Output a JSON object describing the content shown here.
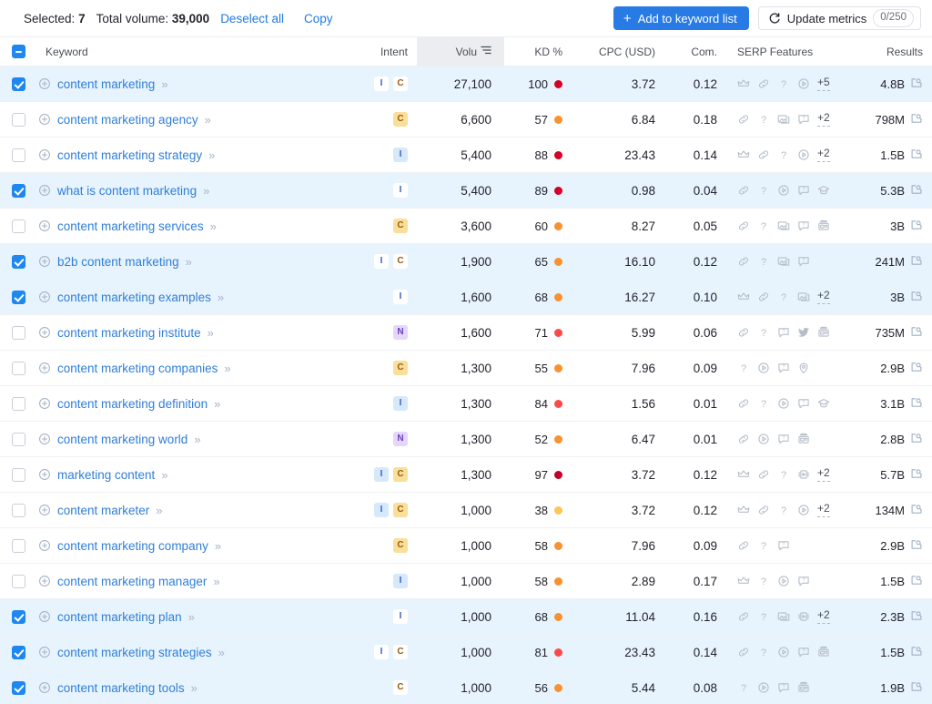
{
  "toolbar": {
    "selected_label": "Selected:",
    "selected_count": "7",
    "volume_label": "Total volume:",
    "volume_value": "39,000",
    "deselect_all": "Deselect all",
    "copy": "Copy",
    "add_to_list": "Add to keyword list",
    "update_metrics": "Update metrics",
    "update_quota": "0/250",
    "accent": "#287be5"
  },
  "table": {
    "columns": {
      "keyword": "Keyword",
      "intent": "Intent",
      "volume": "Volu",
      "kd": "KD %",
      "cpc": "CPC (USD)",
      "com": "Com.",
      "serp": "SERP Features",
      "results": "Results"
    },
    "sorted_column": "volume",
    "header_checkbox_state": "indeterminate",
    "rows": [
      {
        "selected": true,
        "keyword": "content marketing",
        "intents": [
          "I",
          "C"
        ],
        "volume": "27,100",
        "kd": "100",
        "kd_color": "#d40026",
        "cpc": "3.72",
        "com": "0.12",
        "serp": [
          "crown",
          "link",
          "question",
          "video"
        ],
        "serp_more": "+5",
        "results": "4.8B"
      },
      {
        "selected": false,
        "keyword": "content marketing agency",
        "intents": [
          "C"
        ],
        "volume": "6,600",
        "kd": "57",
        "kd_color": "#f8912f",
        "cpc": "6.84",
        "com": "0.18",
        "serp": [
          "link",
          "question",
          "image",
          "faq"
        ],
        "serp_more": "+2",
        "results": "798M"
      },
      {
        "selected": false,
        "keyword": "content marketing strategy",
        "intents": [
          "I"
        ],
        "volume": "5,400",
        "kd": "88",
        "kd_color": "#d40026",
        "cpc": "23.43",
        "com": "0.14",
        "serp": [
          "crown",
          "link",
          "question",
          "video"
        ],
        "serp_more": "+2",
        "results": "1.5B"
      },
      {
        "selected": true,
        "keyword": "what is content marketing",
        "intents": [
          "I"
        ],
        "volume": "5,400",
        "kd": "89",
        "kd_color": "#d40026",
        "cpc": "0.98",
        "com": "0.04",
        "serp": [
          "link",
          "question",
          "video",
          "faq",
          "scholar"
        ],
        "serp_more": "",
        "results": "5.3B"
      },
      {
        "selected": false,
        "keyword": "content marketing services",
        "intents": [
          "C"
        ],
        "volume": "3,600",
        "kd": "60",
        "kd_color": "#f8912f",
        "cpc": "8.27",
        "com": "0.05",
        "serp": [
          "link",
          "question",
          "image",
          "faq",
          "news"
        ],
        "serp_more": "",
        "results": "3B"
      },
      {
        "selected": true,
        "keyword": "b2b content marketing",
        "intents": [
          "I",
          "C"
        ],
        "volume": "1,900",
        "kd": "65",
        "kd_color": "#f8912f",
        "cpc": "16.10",
        "com": "0.12",
        "serp": [
          "link",
          "question",
          "image",
          "faq"
        ],
        "serp_more": "",
        "results": "241M"
      },
      {
        "selected": true,
        "keyword": "content marketing examples",
        "intents": [
          "I"
        ],
        "volume": "1,600",
        "kd": "68",
        "kd_color": "#f8912f",
        "cpc": "16.27",
        "com": "0.10",
        "serp": [
          "crown",
          "link",
          "question",
          "image"
        ],
        "serp_more": "+2",
        "results": "3B"
      },
      {
        "selected": false,
        "keyword": "content marketing institute",
        "intents": [
          "N"
        ],
        "volume": "1,600",
        "kd": "71",
        "kd_color": "#fb4a4a",
        "cpc": "5.99",
        "com": "0.06",
        "serp": [
          "link",
          "question",
          "faq",
          "twitter",
          "news"
        ],
        "serp_more": "",
        "results": "735M"
      },
      {
        "selected": false,
        "keyword": "content marketing companies",
        "intents": [
          "C"
        ],
        "volume": "1,300",
        "kd": "55",
        "kd_color": "#f8912f",
        "cpc": "7.96",
        "com": "0.09",
        "serp": [
          "question",
          "video",
          "faq",
          "local"
        ],
        "serp_more": "",
        "results": "2.9B"
      },
      {
        "selected": false,
        "keyword": "content marketing definition",
        "intents": [
          "I"
        ],
        "volume": "1,300",
        "kd": "84",
        "kd_color": "#fb4a4a",
        "cpc": "1.56",
        "com": "0.01",
        "serp": [
          "link",
          "question",
          "video",
          "faq",
          "scholar"
        ],
        "serp_more": "",
        "results": "3.1B"
      },
      {
        "selected": false,
        "keyword": "content marketing world",
        "intents": [
          "N"
        ],
        "volume": "1,300",
        "kd": "52",
        "kd_color": "#f8912f",
        "cpc": "6.47",
        "com": "0.01",
        "serp": [
          "link",
          "video",
          "faq",
          "news"
        ],
        "serp_more": "",
        "results": "2.8B"
      },
      {
        "selected": false,
        "keyword": "marketing content",
        "intents": [
          "I",
          "C"
        ],
        "volume": "1,300",
        "kd": "97",
        "kd_color": "#c2002a",
        "cpc": "3.72",
        "com": "0.12",
        "serp": [
          "crown",
          "link",
          "question",
          "carousel"
        ],
        "serp_more": "+2",
        "results": "5.7B"
      },
      {
        "selected": false,
        "keyword": "content marketer",
        "intents": [
          "I",
          "C"
        ],
        "volume": "1,000",
        "kd": "38",
        "kd_color": "#fbc756",
        "cpc": "3.72",
        "com": "0.12",
        "serp": [
          "crown",
          "link",
          "question",
          "video"
        ],
        "serp_more": "+2",
        "results": "134M"
      },
      {
        "selected": false,
        "keyword": "content marketing company",
        "intents": [
          "C"
        ],
        "volume": "1,000",
        "kd": "58",
        "kd_color": "#f8912f",
        "cpc": "7.96",
        "com": "0.09",
        "serp": [
          "link",
          "question",
          "faq"
        ],
        "serp_more": "",
        "results": "2.9B"
      },
      {
        "selected": false,
        "keyword": "content marketing manager",
        "intents": [
          "I"
        ],
        "volume": "1,000",
        "kd": "58",
        "kd_color": "#f8912f",
        "cpc": "2.89",
        "com": "0.17",
        "serp": [
          "crown",
          "question",
          "video",
          "faq"
        ],
        "serp_more": "",
        "results": "1.5B"
      },
      {
        "selected": true,
        "keyword": "content marketing plan",
        "intents": [
          "I"
        ],
        "volume": "1,000",
        "kd": "68",
        "kd_color": "#f8912f",
        "cpc": "11.04",
        "com": "0.16",
        "serp": [
          "link",
          "question",
          "image",
          "carousel"
        ],
        "serp_more": "+2",
        "results": "2.3B"
      },
      {
        "selected": true,
        "keyword": "content marketing strategies",
        "intents": [
          "I",
          "C"
        ],
        "volume": "1,000",
        "kd": "81",
        "kd_color": "#fb4a4a",
        "cpc": "23.43",
        "com": "0.14",
        "serp": [
          "link",
          "question",
          "video",
          "faq",
          "news"
        ],
        "serp_more": "",
        "results": "1.5B"
      },
      {
        "selected": true,
        "keyword": "content marketing tools",
        "intents": [
          "C"
        ],
        "volume": "1,000",
        "kd": "56",
        "kd_color": "#f8912f",
        "cpc": "5.44",
        "com": "0.08",
        "serp": [
          "question",
          "video",
          "faq",
          "news"
        ],
        "serp_more": "",
        "results": "1.9B"
      }
    ]
  }
}
